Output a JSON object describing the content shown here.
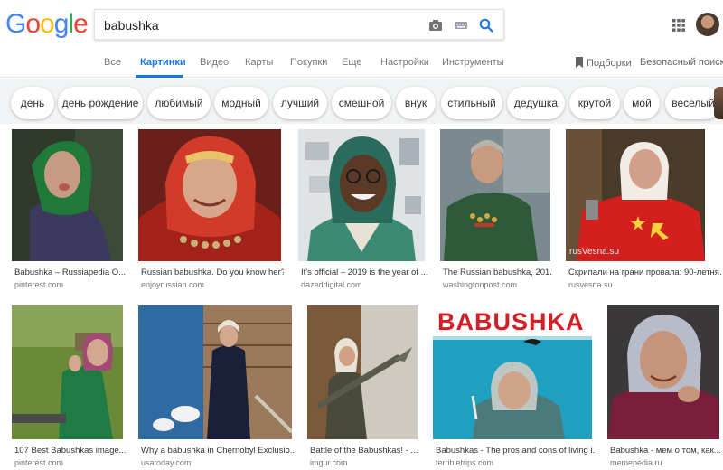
{
  "logo": {
    "letters": [
      "G",
      "o",
      "o",
      "g",
      "l",
      "e"
    ],
    "colors": [
      "#4285f4",
      "#ea4335",
      "#fbbc05",
      "#4285f4",
      "#34a853",
      "#ea4335"
    ]
  },
  "search": {
    "query": "babushka",
    "icons": [
      "camera-icon",
      "keyboard-icon",
      "search-icon"
    ],
    "accent": "#1a73e8"
  },
  "tabs": [
    {
      "label": "Все",
      "active": false
    },
    {
      "label": "Картинки",
      "active": true
    },
    {
      "label": "Видео",
      "active": false
    },
    {
      "label": "Карты",
      "active": false
    },
    {
      "label": "Покупки",
      "active": false
    },
    {
      "label": "Еще",
      "active": false
    },
    {
      "label": "Настройки",
      "active": false
    },
    {
      "label": "Инструменты",
      "active": false
    }
  ],
  "collections_label": "Подборки",
  "safesearch_label": "Безопасный поиск",
  "chips": [
    "день",
    "день рождение",
    "любимый",
    "модный",
    "лучший",
    "смешной",
    "внук",
    "стильный",
    "дедушка",
    "крутой",
    "мой",
    "веселый"
  ],
  "results": [
    {
      "caption": "Babushka – Russiapedia O...",
      "source": "pinterest.com"
    },
    {
      "caption": "Russian babushka. Do you know her?",
      "source": "enjoyrussian.com"
    },
    {
      "caption": "It's official – 2019 is the year of ...",
      "source": "dazeddigital.com"
    },
    {
      "caption": "The Russian babushka, 201...",
      "source": "washingtonpost.com"
    },
    {
      "caption": "Скрипали на грани провала: 90-летня...",
      "source": "rusvesna.su"
    },
    {
      "caption": "107 Best Babushkas image...",
      "source": "pinterest.com"
    },
    {
      "caption": "Why a babushka in Chernobyl Exclusio...",
      "source": "usatoday.com"
    },
    {
      "caption": "Battle of the Babushkas! - ...",
      "source": "imgur.com"
    },
    {
      "caption": "Babushkas - The pros and cons of living i...",
      "source": "terribletrips.com"
    },
    {
      "caption": "Babushka - мем о том, как...",
      "source": "memepedia.ru"
    }
  ],
  "image_texts": {
    "watermark": "rusVesna.su",
    "poster_title": "BABUSHKA"
  }
}
